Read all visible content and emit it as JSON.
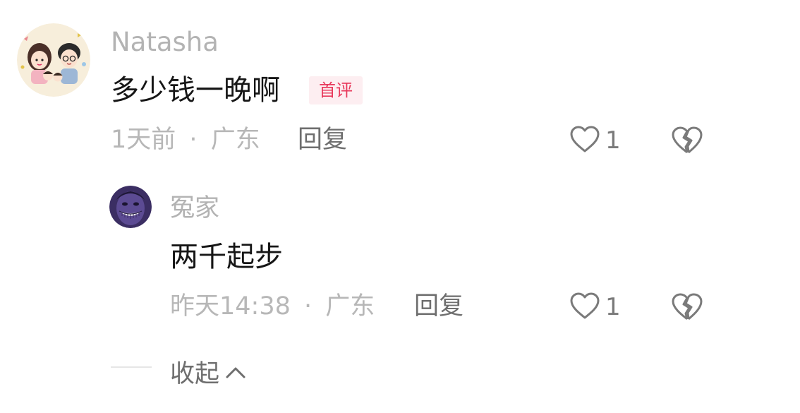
{
  "comments": [
    {
      "user": "Natasha",
      "avatar": "couple-cartoon-avatar",
      "text": "多少钱一晚啊",
      "badge": "首评",
      "time": "1天前",
      "separator": "·",
      "location": "广东",
      "reply_label": "回复",
      "likes": "1",
      "like_icon": "heart-outline-icon",
      "dislike_icon": "broken-heart-icon"
    }
  ],
  "replies": [
    {
      "user": "冤家",
      "avatar": "purple-grin-avatar",
      "text": "两千起步",
      "time": "昨天14:38",
      "separator": "·",
      "location": "广东",
      "reply_label": "回复",
      "likes": "1",
      "like_icon": "heart-outline-icon",
      "dislike_icon": "broken-heart-icon"
    }
  ],
  "collapse": {
    "label": "收起",
    "icon": "chevron-up-icon"
  },
  "colors": {
    "username": "#b3b3b3",
    "body_text": "#161616",
    "meta": "#b7b7b7",
    "badge_bg": "#fdeef1",
    "badge_text": "#e8395c",
    "action": "#6e6e6e"
  }
}
